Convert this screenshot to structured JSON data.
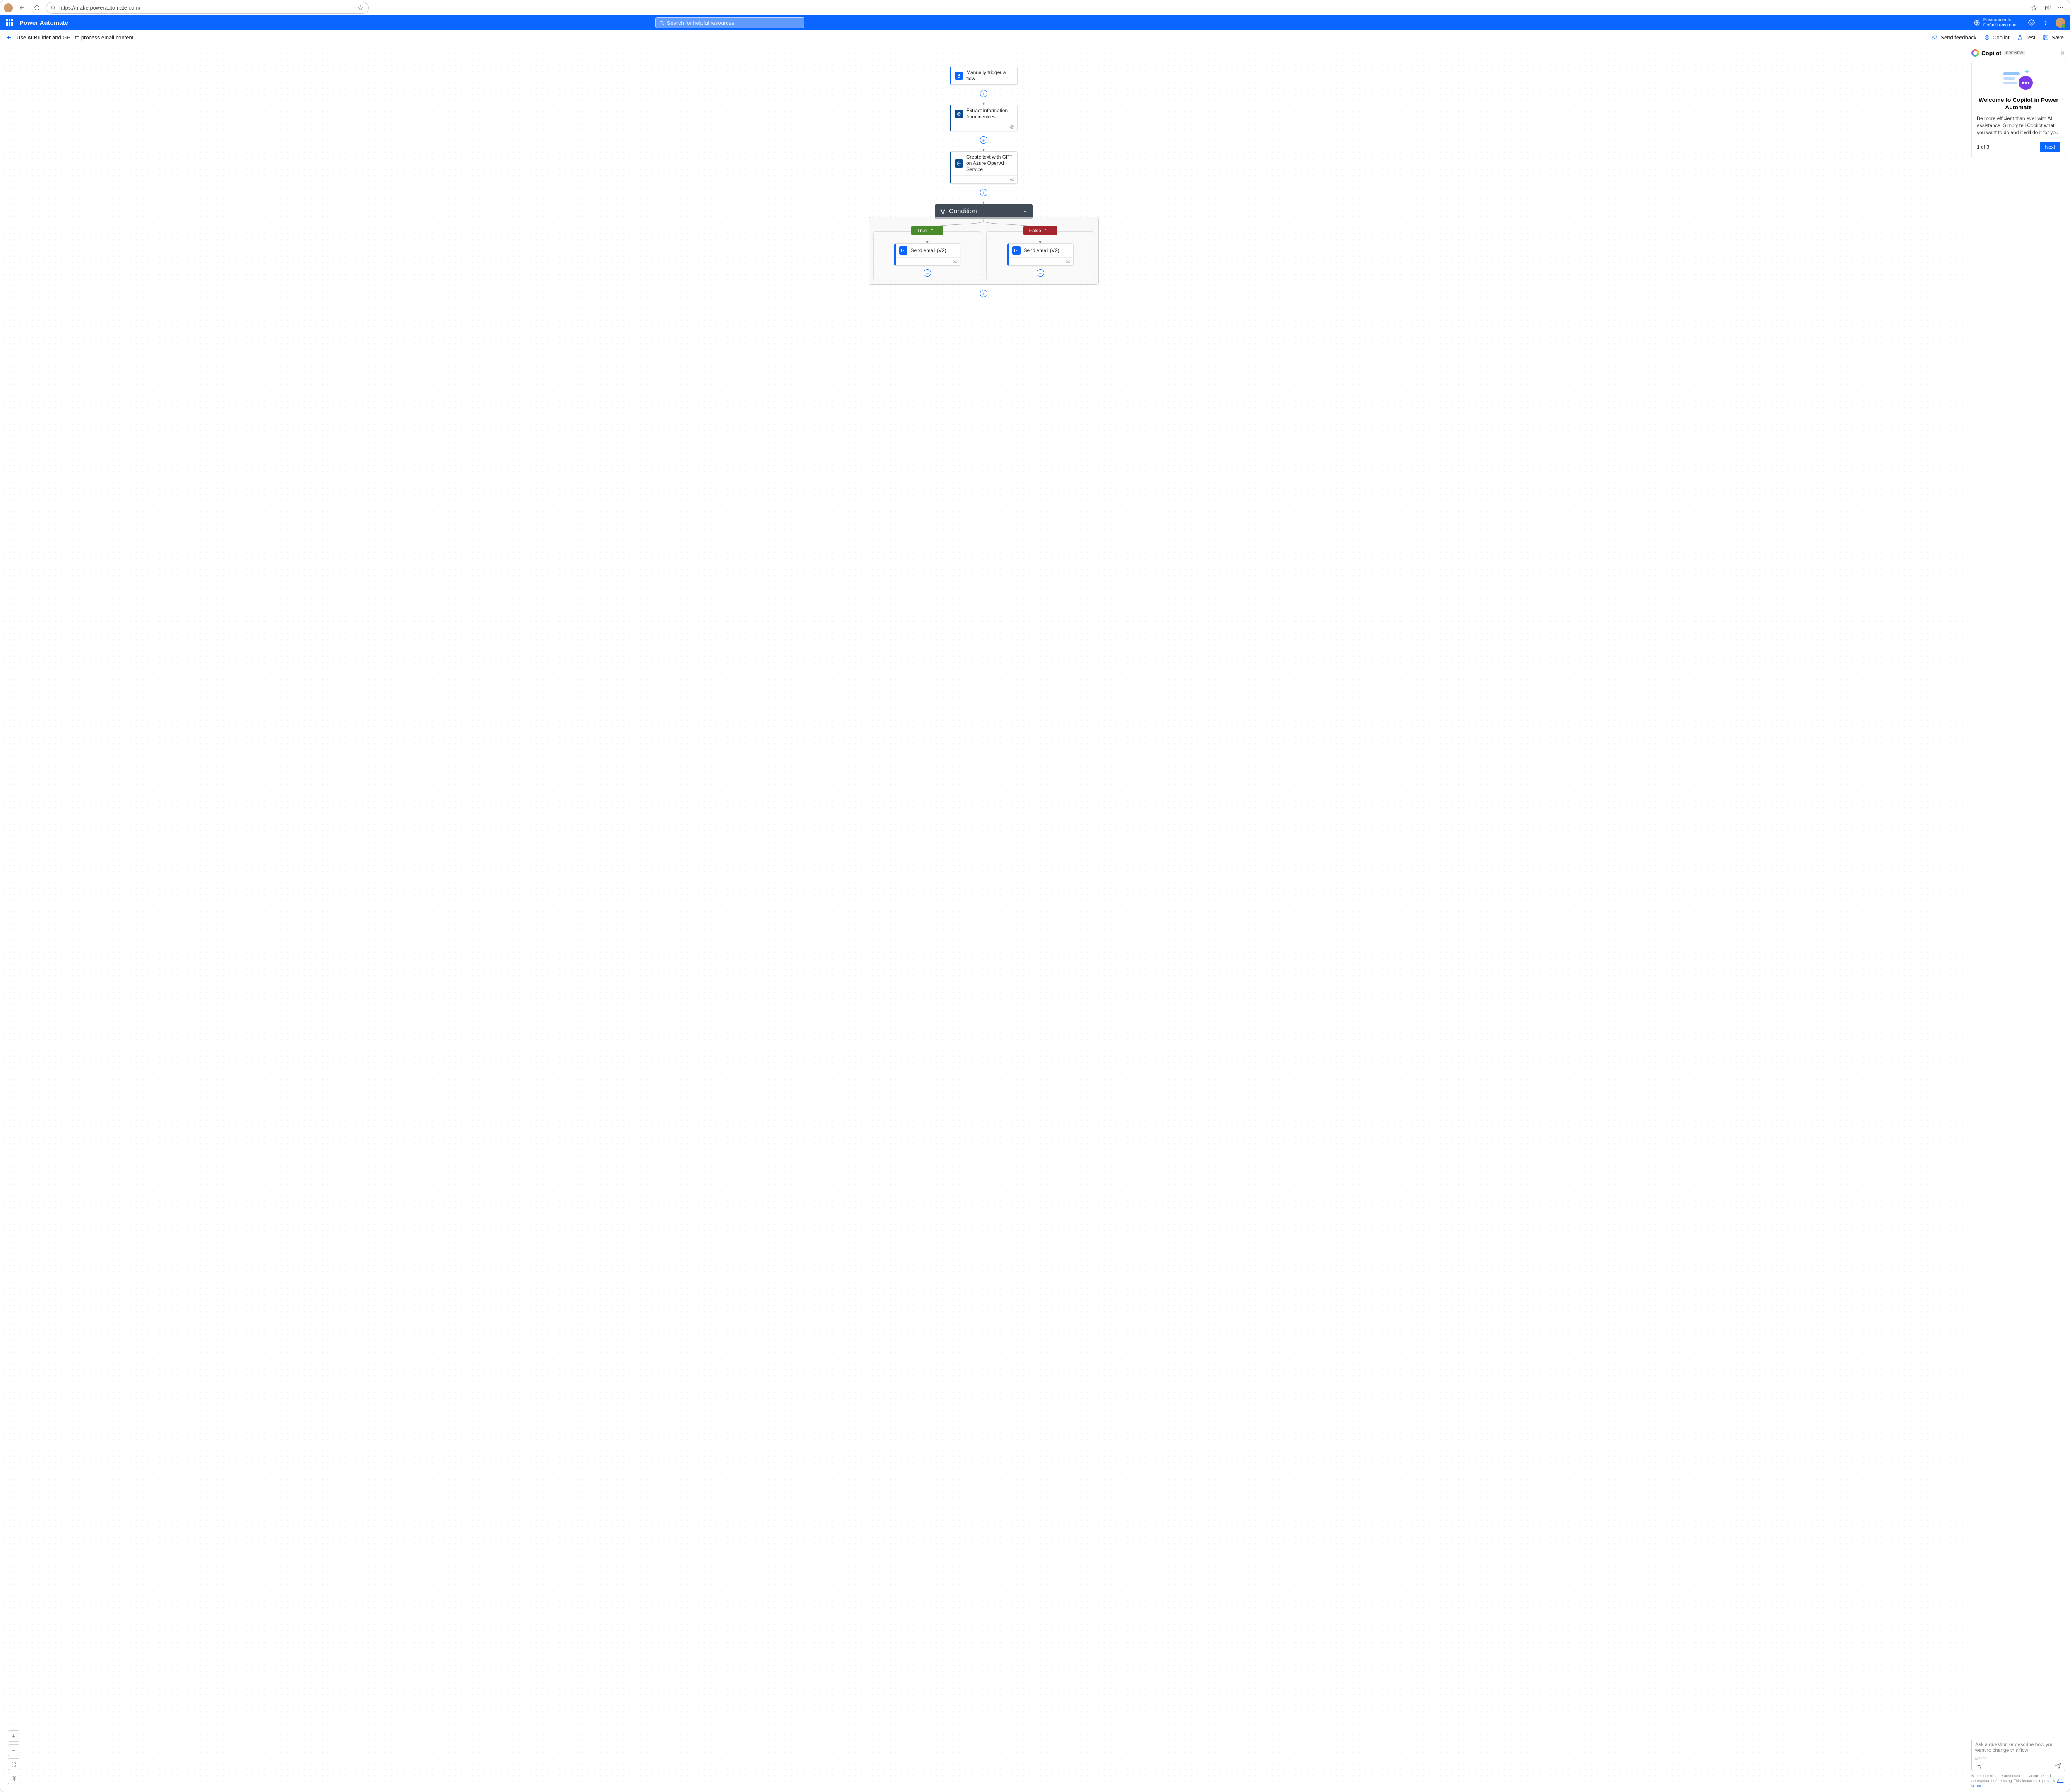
{
  "browser": {
    "url": "https://make.powerautomate.com/"
  },
  "header": {
    "app_title": "Power Automate",
    "search_placeholder": "Search for helpful resources",
    "env_label": "Environments",
    "env_value": "Default environm..."
  },
  "toolbar": {
    "flow_title": "Use AI Builder and GPT to process email content",
    "feedback": "Send feedback",
    "copilot": "Copilot",
    "test": "Test",
    "save": "Save"
  },
  "flow": {
    "step1": "Manually trigger a flow",
    "step2": "Extract information from invoices",
    "step3": "Create text with GPT on Azure OpenAI Service",
    "condition": "Condition",
    "true_label": "True",
    "false_label": "False",
    "send_email": "Send email (V2)"
  },
  "copilot": {
    "title": "Copilot",
    "badge": "PREVIEW",
    "card_title": "Welcome to Copilot in Power Automate",
    "card_body": "Be more efficient than ever with AI assistance. Simply tell Copilot what you want to do and it will do it for you.",
    "step": "1 of 3",
    "next": "Next",
    "input_placeholder": "Ask a question or describe how you want to change this flow",
    "counter": "0/2000",
    "disclaimer_1": "Make sure AI-generated content is accurate and appropriate before using. This feature is in preview. ",
    "disclaimer_link": "See terms"
  }
}
